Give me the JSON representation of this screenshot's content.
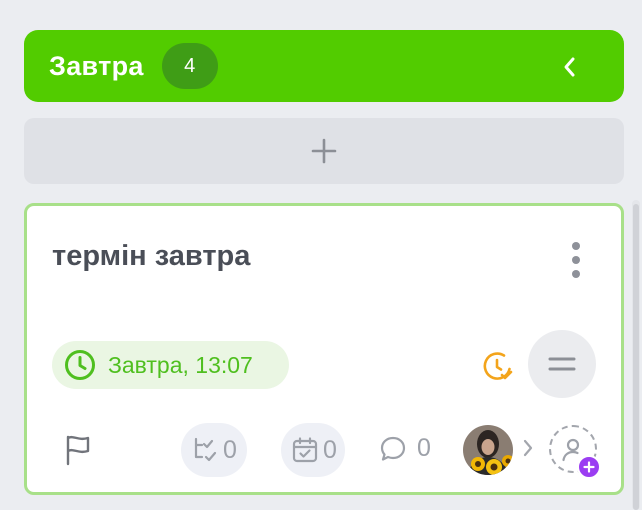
{
  "column": {
    "title": "Завтра",
    "count": "4",
    "accent_color": "#52cc00"
  },
  "add_card": {
    "icon": "plus-icon"
  },
  "card": {
    "title": "термін завтра",
    "due": {
      "label": "Завтра, 13:07",
      "color": "#4fbf1f",
      "icon": "clock-icon"
    },
    "reminder_icon": "alarm-check-icon",
    "priority_icon": "equals-icon",
    "flag_icon": "flag-icon",
    "subtasks_count": "0",
    "checklist_count": "0",
    "comments_count": "0",
    "assignee_avatar": "avatar",
    "add_assignee_icon": "user-plus-icon",
    "border_color": "#a8e089"
  }
}
